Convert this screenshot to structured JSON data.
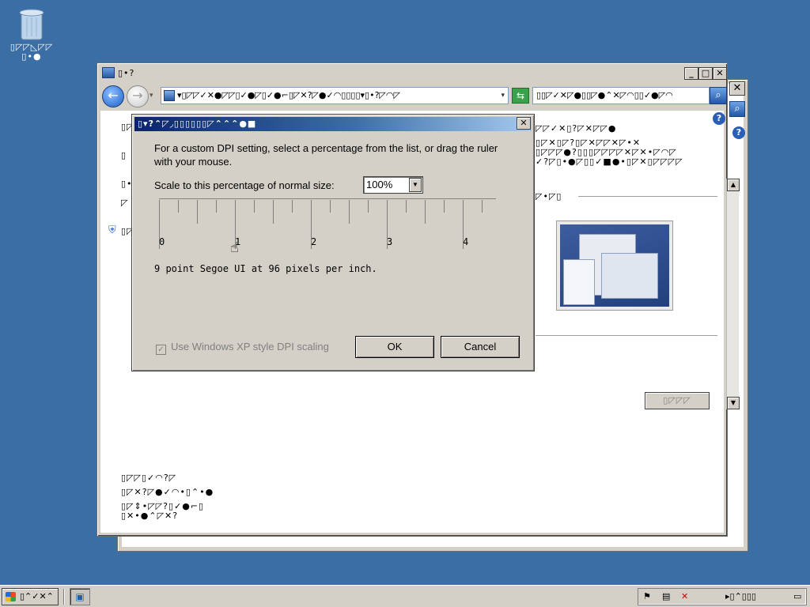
{
  "desktop": {
    "recycle_bin_label": "▯◸◸◺◸◸",
    "recycle_bin_label2": "▯•●"
  },
  "back_window": {
    "close_glyph": "✕",
    "search_glyph": "🔍",
    "help_glyph": "?"
  },
  "browser": {
    "title": "▯•?",
    "address_text": "▾▯◸◸✓✕●◸◸▯✓●◸▯✓●⌐▯◸✕?◸●✓◠▯▯▯▯▾▯•?◸◠◸",
    "search_text": "▯▯◸✓✕◸●▯▯◸●⌃✕◸◠▯▯✓●◸◠",
    "minimize_glyph": "_",
    "maximize_glyph": "□",
    "close_glyph": "✕",
    "back_glyph": "←",
    "forward_glyph": "→",
    "drop_glyph": "▾",
    "refresh_glyph": "⇆",
    "search_glyph": "⌕",
    "help_glyph": "?",
    "shield_glyph": "⛨",
    "garbled": {
      "right1": "◸◸✓✕▯?◸✕◸◸●",
      "right2": "▯◸✕▯◸?▯◸✕◸◸✕◸•✕",
      "right3": "▯◸◸◸●?▯▯▯◸◸◸◸✕◸✕•◸◠◸",
      "right4": "✓?◸▯•●◸▯▯✓■●•▯◸✕▯◸◸◸◸",
      "right5": "◸•◸▯",
      "left1": "▯◸",
      "left2": "▯",
      "left3": "▯•",
      "left4": "◸",
      "left5": "▯◸",
      "bottom1": "▯◸◸▯✓◠?◸",
      "bottom2": "▯◸✕?◸●✓◠•▯⌃•●",
      "bottom3": "▯◸⇕•◸◸?▯✓●⌐▯",
      "bottom4": "▯✕•●⌃◸✕?",
      "grey_button": "▯◸◸◸"
    }
  },
  "dialog": {
    "title": "▯▾?⌃◸◞▯▯▯▯▯▯◸⌃⌃⌃●■",
    "close_glyph": "✕",
    "instruction": "For a custom DPI setting, select a percentage from the list, or drag the ruler with your mouse.",
    "scale_label": "Scale to this percentage of normal size:",
    "scale_value": "100%",
    "ruler_numbers": [
      "0",
      "1",
      "2",
      "3",
      "4"
    ],
    "font_description": "9 point Segoe UI at 96 pixels per inch.",
    "checkbox_label": "Use Windows XP style DPI scaling",
    "checkbox_checked": true,
    "check_glyph": "✓",
    "ok_label": "OK",
    "cancel_label": "Cancel"
  },
  "taskbar": {
    "start_label": "▯⌃✓✕⌃",
    "tray_text": "▸▯⌃▯▯▯",
    "flag_glyph": "⚑",
    "volume_glyph": "🔇"
  }
}
